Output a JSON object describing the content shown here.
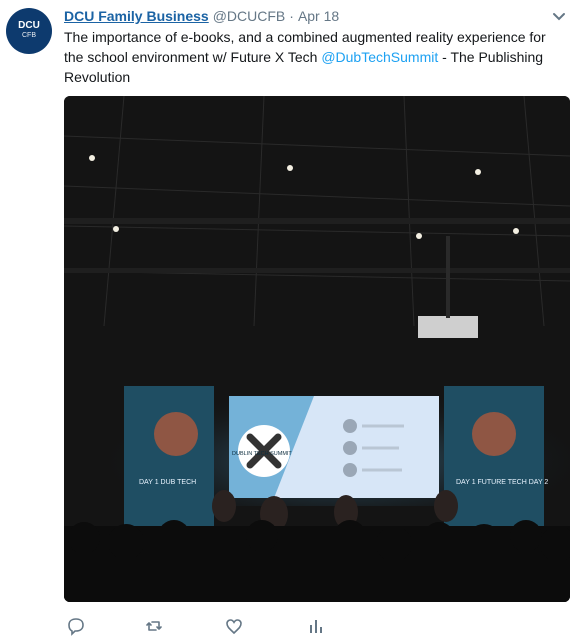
{
  "tweet": {
    "author_name": "DCU Family Business",
    "author_handle": "@DCUCFB",
    "separator": "·",
    "timestamp": "Apr 18",
    "text_before": "The importance of e-books, and a combined augmented reality experience for the school environment w/ Future X Tech ",
    "mention": "@DubTechSummit",
    "text_after": " - The Publishing Revolution",
    "avatar_text": "DCU",
    "avatar_subtext": "CFB"
  },
  "photo": {
    "screen_title": "DUBLIN TECH SUMMIT",
    "banner_left": "DAY 1  DUB TECH",
    "banner_right": "DAY 1  FUTURE TECH  DAY 2"
  },
  "actions": [
    "reply-icon",
    "retweet-icon",
    "like-icon",
    "analytics-icon"
  ],
  "colors": {
    "name": "#1b63a4",
    "mention": "#1da1f2",
    "muted": "#657786",
    "text": "#14171a"
  }
}
